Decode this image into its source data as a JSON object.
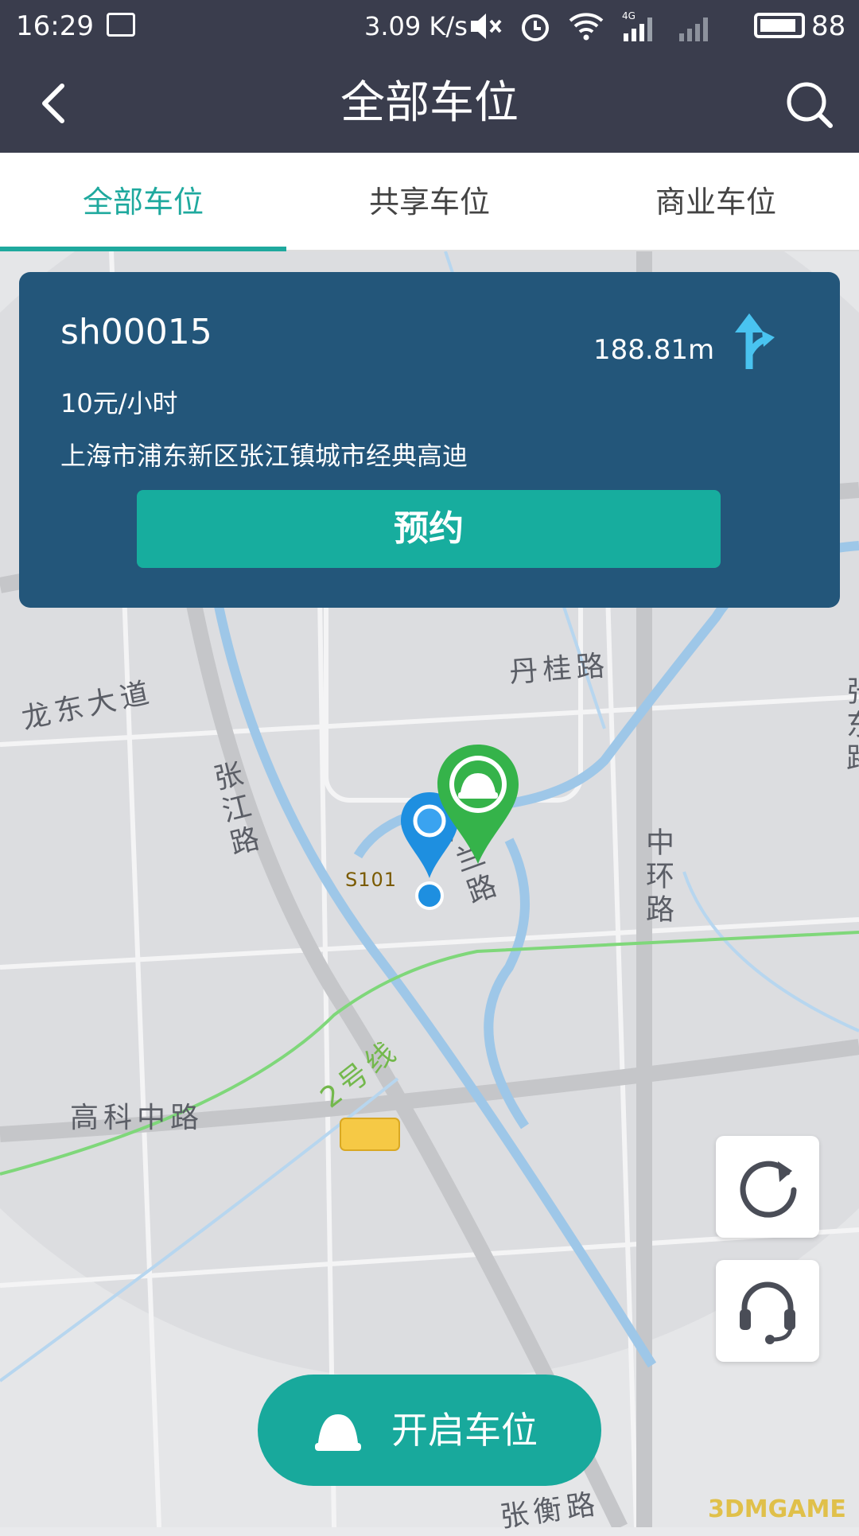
{
  "status_bar": {
    "time": "16:29",
    "speed": "3.09 K/s",
    "network": "4G",
    "battery": "88"
  },
  "header": {
    "title": "全部车位"
  },
  "tabs": [
    {
      "label": "全部车位",
      "active": true
    },
    {
      "label": "共享车位",
      "active": false
    },
    {
      "label": "商业车位",
      "active": false
    }
  ],
  "parking_card": {
    "code": "sh00015",
    "distance": "188.81m",
    "price": "10元/小时",
    "address": "上海市浦东新区张江镇城市经典高迪",
    "reserve_label": "预约"
  },
  "map": {
    "labels": {
      "longdong": "龙东大道",
      "zhangjiang": "张江路",
      "dangui": "丹桂路",
      "zhonghuan": "中环路",
      "line2": "2号线",
      "guanglan": "广兰路",
      "s101": "S101",
      "gaoke": "高科中路",
      "zhangdong": "张东路",
      "zhangheng": "张衡路"
    }
  },
  "open_button": {
    "label": "开启车位"
  },
  "watermark": "3DMGAME",
  "colors": {
    "header_bg": "#3a3d4d",
    "accent": "#1fa99e",
    "card_bg": "#23567a",
    "pin_blue": "#1e8fe0",
    "pin_green": "#35b34a"
  }
}
